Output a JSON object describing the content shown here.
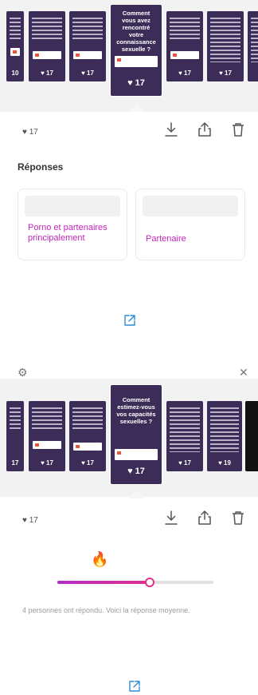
{
  "panel1": {
    "thumbnails": [
      {
        "likes": "10",
        "has_card": true
      },
      {
        "likes": "♥ 17",
        "has_card": true
      },
      {
        "likes": "♥ 17",
        "has_card": true
      },
      {
        "likes": "♥ 17",
        "has_card": true
      },
      {
        "likes": "♥ 17",
        "has_card": true
      }
    ],
    "featured": {
      "title": "Comment vous avez rencontré votre connaissance sexuelle ?",
      "likes": "♥ 17"
    },
    "likes": "♥ 17",
    "responses_title": "Réponses",
    "answers": [
      "Porno et partenaires principalement",
      "Partenaire"
    ]
  },
  "panel2": {
    "thumbnails": [
      {
        "likes": "17"
      },
      {
        "likes": "♥ 17"
      },
      {
        "likes": "♥ 17"
      },
      {
        "likes": "♥ 17"
      },
      {
        "likes": "♥ 19"
      }
    ],
    "featured": {
      "title": "Comment estimez-vous vos capacités sexuelles ?",
      "likes": "♥ 17"
    },
    "likes": "♥ 17",
    "slider": {
      "emoji": "🔥",
      "value_percent": 59
    },
    "result_text": "4 personnes ont répondu. Voici la réponse moyenne.",
    "corner_left": "⚙",
    "corner_right": "✕"
  },
  "colors": {
    "story_bg": "#3b2d57",
    "accent": "#c026b8"
  },
  "icons": [
    "download-icon",
    "share-icon",
    "trash-icon",
    "external-link-icon",
    "fire-emoji"
  ]
}
